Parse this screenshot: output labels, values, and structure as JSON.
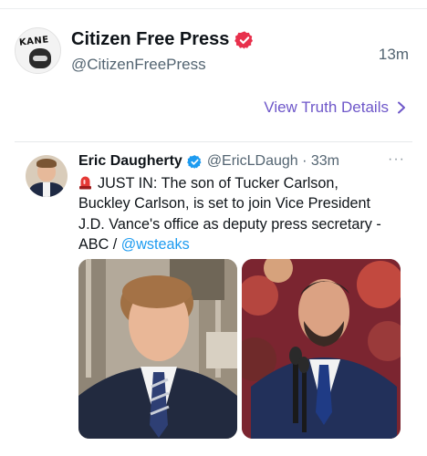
{
  "post": {
    "display_name": "Citizen Free Press",
    "handle": "@CitizenFreePress",
    "time": "13m",
    "avatar_text": "KANE",
    "view_details_label": "View Truth Details"
  },
  "quoted": {
    "name": "Eric Daugherty",
    "handle_time": "@EricLDaugh · 33m",
    "more_label": "···",
    "body_lines": [
      "JUST IN: The son of Tucker Carlson,",
      "Buckley Carlson, is set to join Vice President",
      "J.D. Vance's office as deputy press secretary -"
    ],
    "last_line_prefix": "ABC / ",
    "mention": "@wsteaks"
  },
  "colors": {
    "verified_badge": "#e8304c",
    "verified_blue": "#1d9bf0",
    "link_purple": "#6e57c9",
    "siren_red": "#e53935"
  },
  "icons": {
    "verified_main": "verified-badge-icon",
    "verified_quote": "verified-check-icon",
    "chevron": "chevron-right-icon",
    "siren": "rotating-light-icon",
    "more": "more-horizontal-icon"
  }
}
